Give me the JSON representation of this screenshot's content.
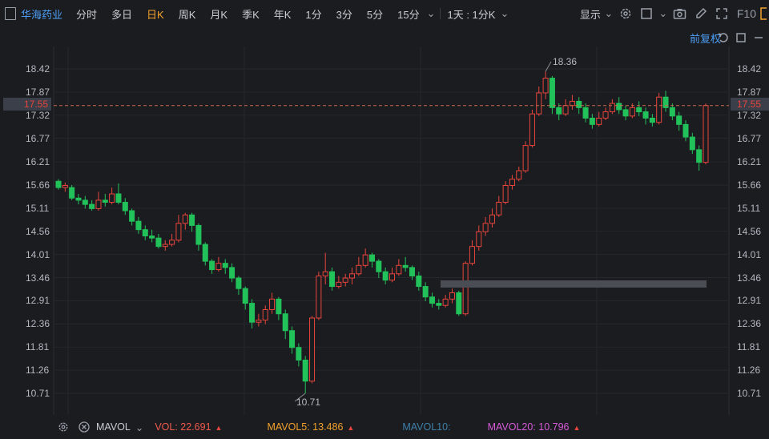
{
  "toolbar": {
    "stock_name": "华海药业",
    "periods": [
      "分时",
      "多日",
      "日K",
      "周K",
      "月K",
      "季K",
      "年K",
      "1分",
      "3分",
      "5分",
      "15分"
    ],
    "active_period": "日K",
    "interval_select": "1天 : 1分K",
    "display_label": "显示",
    "f10_label": "F10"
  },
  "adjust_label": "前复权",
  "y_axis": {
    "ticks": [
      "18.42",
      "17.87",
      "17.32",
      "16.77",
      "16.21",
      "15.66",
      "15.11",
      "14.56",
      "14.01",
      "13.46",
      "12.91",
      "12.36",
      "11.81",
      "11.26",
      "10.71"
    ],
    "current_price": "17.55",
    "range": [
      10.71,
      18.42
    ]
  },
  "annotations": {
    "high": "18.36",
    "low": "10.71"
  },
  "indicator_bar": {
    "name": "MAVOL",
    "vol": "VOL: 22.691",
    "mavol5": "MAVOL5: 13.486",
    "mavol10": "MAVOL10:",
    "mavol20": "MAVOL20: 10.796"
  },
  "colors": {
    "up": "#e8453c",
    "down": "#22c25a",
    "accent_blue": "#4d9ef5",
    "accent_orange": "#f2a12c",
    "vol_color": "#f05a4c",
    "mavol5_color": "#f2a12c",
    "mavol10_color": "#3f7fa8",
    "mavol20_color": "#d75ad8"
  },
  "chart_data": {
    "type": "candlestick",
    "ylim": [
      10.71,
      18.42
    ],
    "grid": true,
    "current_price": 17.55,
    "candles": [
      [
        15.75,
        15.6,
        15.8,
        15.55
      ],
      [
        15.6,
        15.65,
        15.72,
        15.5
      ],
      [
        15.6,
        15.35,
        15.66,
        15.3
      ],
      [
        15.35,
        15.3,
        15.45,
        15.2
      ],
      [
        15.3,
        15.2,
        15.4,
        15.1
      ],
      [
        15.2,
        15.1,
        15.3,
        15.05
      ],
      [
        15.1,
        15.3,
        15.5,
        15.05
      ],
      [
        15.3,
        15.25,
        15.45,
        15.15
      ],
      [
        15.25,
        15.45,
        15.6,
        15.2
      ],
      [
        15.45,
        15.25,
        15.7,
        15.2
      ],
      [
        15.25,
        15.05,
        15.35,
        14.95
      ],
      [
        15.05,
        14.8,
        15.1,
        14.7
      ],
      [
        14.8,
        14.6,
        14.9,
        14.5
      ],
      [
        14.6,
        14.45,
        14.7,
        14.35
      ],
      [
        14.45,
        14.4,
        14.6,
        14.3
      ],
      [
        14.4,
        14.2,
        14.5,
        14.15
      ],
      [
        14.2,
        14.25,
        14.35,
        14.1
      ],
      [
        14.25,
        14.35,
        14.5,
        14.2
      ],
      [
        14.35,
        14.75,
        14.95,
        14.3
      ],
      [
        14.75,
        14.95,
        15.0,
        14.6
      ],
      [
        14.95,
        14.7,
        15.0,
        14.55
      ],
      [
        14.7,
        14.25,
        14.75,
        14.1
      ],
      [
        14.25,
        13.85,
        14.3,
        13.75
      ],
      [
        13.85,
        13.65,
        13.9,
        13.55
      ],
      [
        13.65,
        13.8,
        13.95,
        13.6
      ],
      [
        13.8,
        13.7,
        13.9,
        13.55
      ],
      [
        13.7,
        13.45,
        13.8,
        13.35
      ],
      [
        13.45,
        13.2,
        13.5,
        13.05
      ],
      [
        13.2,
        12.85,
        13.25,
        12.7
      ],
      [
        12.85,
        12.4,
        12.95,
        12.25
      ],
      [
        12.4,
        12.45,
        12.6,
        12.3
      ],
      [
        12.45,
        12.7,
        12.8,
        12.35
      ],
      [
        12.7,
        12.95,
        13.1,
        12.6
      ],
      [
        12.95,
        12.6,
        13.0,
        12.45
      ],
      [
        12.6,
        12.2,
        12.7,
        12.0
      ],
      [
        12.2,
        11.8,
        12.3,
        11.65
      ],
      [
        11.8,
        11.5,
        11.9,
        11.35
      ],
      [
        11.5,
        11.0,
        11.6,
        10.71
      ],
      [
        11.0,
        12.5,
        12.55,
        10.95
      ],
      [
        12.5,
        13.5,
        13.6,
        12.45
      ],
      [
        13.5,
        13.6,
        14.05,
        13.3
      ],
      [
        13.6,
        13.25,
        13.7,
        13.15
      ],
      [
        13.25,
        13.35,
        13.5,
        13.2
      ],
      [
        13.35,
        13.45,
        13.55,
        13.25
      ],
      [
        13.45,
        13.55,
        13.7,
        13.3
      ],
      [
        13.55,
        13.75,
        13.95,
        13.5
      ],
      [
        13.75,
        14.0,
        14.15,
        13.7
      ],
      [
        14.0,
        13.85,
        14.05,
        13.7
      ],
      [
        13.85,
        13.6,
        13.9,
        13.45
      ],
      [
        13.6,
        13.4,
        13.7,
        13.3
      ],
      [
        13.4,
        13.55,
        13.7,
        13.35
      ],
      [
        13.55,
        13.75,
        13.9,
        13.5
      ],
      [
        13.75,
        13.7,
        13.95,
        13.6
      ],
      [
        13.7,
        13.5,
        13.75,
        13.4
      ],
      [
        13.5,
        13.25,
        13.6,
        13.15
      ],
      [
        13.25,
        13.0,
        13.35,
        12.9
      ],
      [
        13.0,
        12.85,
        13.1,
        12.75
      ],
      [
        12.85,
        12.8,
        12.95,
        12.7
      ],
      [
        12.8,
        12.95,
        13.05,
        12.75
      ],
      [
        12.95,
        13.1,
        13.2,
        12.85
      ],
      [
        13.1,
        12.6,
        13.15,
        12.55
      ],
      [
        12.6,
        13.8,
        13.85,
        12.55
      ],
      [
        13.8,
        14.2,
        14.35,
        13.75
      ],
      [
        14.2,
        14.55,
        14.7,
        14.1
      ],
      [
        14.55,
        14.75,
        14.9,
        14.45
      ],
      [
        14.75,
        14.95,
        15.1,
        14.65
      ],
      [
        14.95,
        15.25,
        15.4,
        14.9
      ],
      [
        15.25,
        15.65,
        15.75,
        15.2
      ],
      [
        15.65,
        15.8,
        15.9,
        15.55
      ],
      [
        15.8,
        16.0,
        16.1,
        15.75
      ],
      [
        16.0,
        16.6,
        16.7,
        15.95
      ],
      [
        16.6,
        17.35,
        17.45,
        16.55
      ],
      [
        17.35,
        17.85,
        18.0,
        17.3
      ],
      [
        17.85,
        18.2,
        18.36,
        17.7
      ],
      [
        18.2,
        17.5,
        18.25,
        17.35
      ],
      [
        17.5,
        17.35,
        17.6,
        17.2
      ],
      [
        17.35,
        17.55,
        17.7,
        17.3
      ],
      [
        17.55,
        17.65,
        17.8,
        17.45
      ],
      [
        17.65,
        17.5,
        17.75,
        17.35
      ],
      [
        17.5,
        17.25,
        17.6,
        17.15
      ],
      [
        17.25,
        17.1,
        17.35,
        17.0
      ],
      [
        17.1,
        17.25,
        17.4,
        17.05
      ],
      [
        17.25,
        17.4,
        17.5,
        17.2
      ],
      [
        17.4,
        17.6,
        17.7,
        17.35
      ],
      [
        17.6,
        17.45,
        17.75,
        17.35
      ],
      [
        17.45,
        17.3,
        17.55,
        17.2
      ],
      [
        17.3,
        17.5,
        17.6,
        17.25
      ],
      [
        17.5,
        17.4,
        17.65,
        17.3
      ],
      [
        17.4,
        17.25,
        17.5,
        17.1
      ],
      [
        17.25,
        17.15,
        17.35,
        17.05
      ],
      [
        17.15,
        17.75,
        17.85,
        17.1
      ],
      [
        17.75,
        17.5,
        17.9,
        17.4
      ],
      [
        17.5,
        17.3,
        17.6,
        17.2
      ],
      [
        17.3,
        17.1,
        17.4,
        16.95
      ],
      [
        17.1,
        16.8,
        17.2,
        16.7
      ],
      [
        16.8,
        16.5,
        16.9,
        16.4
      ],
      [
        16.5,
        16.2,
        16.6,
        16.0
      ],
      [
        16.2,
        17.55,
        17.6,
        16.15
      ]
    ]
  }
}
